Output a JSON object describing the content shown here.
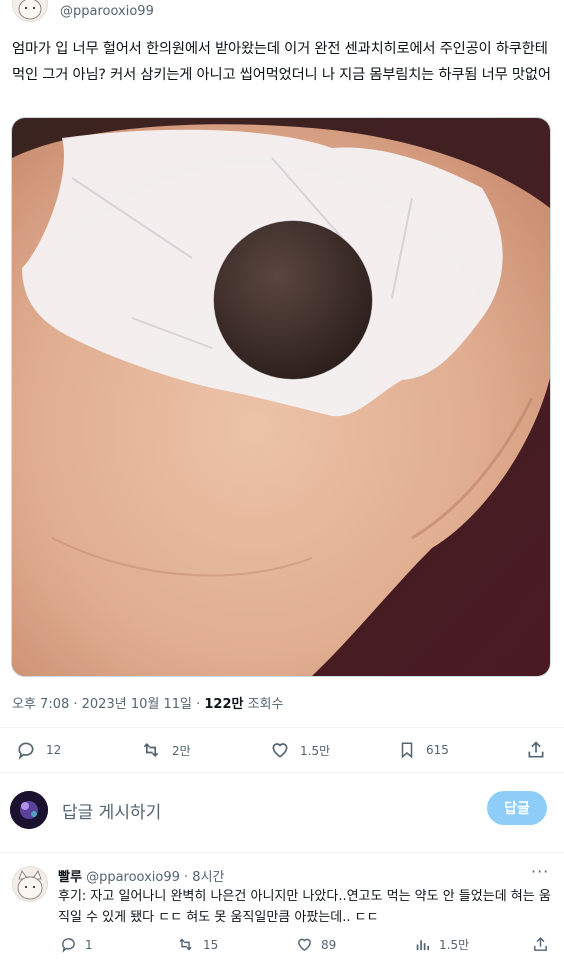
{
  "tweet": {
    "handle": "@pparooxio99",
    "text": "엄마가 입 너무 헐어서 한의원에서 받아왔는데 이거 완전 센과치히로에서 주인공이 하쿠한테 먹인 그거 아님? 커서 삼키는게 아니고 씹어먹었더니 나 지금 몸부림치는 하쿠됨 너무 맛없어",
    "time": "오후 7:08 · 2023년 10월 11일 · ",
    "views_count": "122만",
    "views_label": " 조회수"
  },
  "actions": {
    "reply_count": "12",
    "retweet_count": "2만",
    "like_count": "1.5만",
    "bookmark_count": "615"
  },
  "reply_composer": {
    "placeholder": "답글 게시하기",
    "button_label": "답글"
  },
  "reply": {
    "name": "빨루",
    "handle": "@pparooxio99",
    "time": " · 8시간",
    "more": "···",
    "text": "후기: 자고 일어나니 완벽히 나은건 아니지만 나았다..연고도 먹는 약도 안 들었는데 혀는 움직일 수 있게 됐다 ㄷㄷ 혀도 못 움직일만큼 아팠는데.. ㄷㄷ",
    "reply_count": "1",
    "retweet_count": "15",
    "like_count": "89",
    "view_count": "1.5만"
  },
  "colors": {
    "text": "#0f1419",
    "muted": "#536471",
    "reply_button": "#8ecdf8",
    "divider": "#eff3f4"
  }
}
